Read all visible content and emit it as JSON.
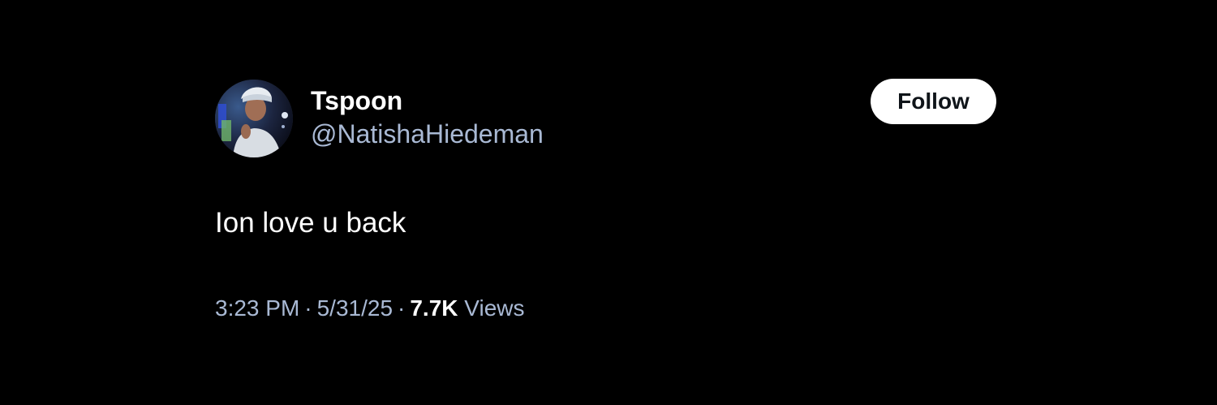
{
  "author": {
    "display_name": "Tspoon",
    "handle": "@NatishaHiedeman"
  },
  "follow_button": {
    "label": "Follow"
  },
  "tweet": {
    "text": "Ion love u back",
    "time": "3:23 PM",
    "date": "5/31/25",
    "separator": "·",
    "views_count": "7.7K",
    "views_label": "Views"
  },
  "colors": {
    "background": "#000000",
    "primary_text": "#ffffff",
    "secondary_text": "#a9b9d4",
    "follow_button_bg": "#ffffff",
    "follow_button_text": "#0f1419"
  },
  "icons": {
    "avatar": "profile-photo"
  }
}
